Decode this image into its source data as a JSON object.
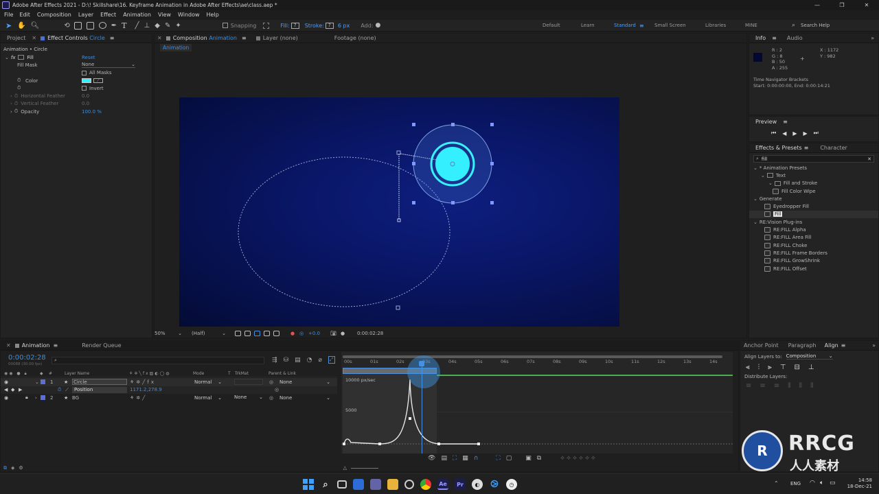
{
  "window": {
    "title": "Adobe After Effects 2021 - D:\\! Skillshare\\16. Keyframe Animation in Adobe After Effects\\ae\\class.aep *",
    "minimize": "—",
    "maximize": "❐",
    "close": "✕"
  },
  "menu": [
    "File",
    "Edit",
    "Composition",
    "Layer",
    "Effect",
    "Animation",
    "View",
    "Window",
    "Help"
  ],
  "toolbar": {
    "snapping": "Snapping",
    "fill_label": "Fill:",
    "stroke_label": "Stroke:",
    "stroke_width": "6 px",
    "add_label": "Add:",
    "workspaces": [
      "Default",
      "Learn",
      "Standard",
      "Small Screen",
      "Libraries",
      "MINE"
    ],
    "active_workspace": "Standard",
    "search": "Search Help"
  },
  "effect_controls": {
    "tab_project": "Project",
    "tab_label": "Effect Controls",
    "tab_layer": "Circle",
    "header": "Animation • Circle",
    "effect_name": "Fill",
    "reset": "Reset",
    "fill_mask_label": "Fill Mask",
    "fill_mask_value": "None",
    "all_masks": "All Masks",
    "color_label": "Color",
    "invert": "Invert",
    "h_feather": "Horizontal Feather",
    "h_feather_val": "0.0",
    "v_feather": "Vertical Feather",
    "v_feather_val": "0.0",
    "opacity_label": "Opacity",
    "opacity_val": "100.0 %",
    "swatch_color": "#34f0ff"
  },
  "composition": {
    "tab_label": "Composition",
    "tab_comp": "Animation",
    "layer_tab": "Layer (none)",
    "footage_tab": "Footage (none)",
    "sub_tab": "Animation",
    "zoom": "50%",
    "resolution": "(Half)",
    "exposure": "+0.0",
    "timecode": "0:00:02:28"
  },
  "info": {
    "tab_info": "Info",
    "tab_audio": "Audio",
    "r": "R : 2",
    "g": "G : 8",
    "b": "B : 50",
    "a": "A : 255",
    "x": "X : 1172",
    "y": "Y : 982",
    "nav_title": "Time Navigator Brackets",
    "nav_range": "Start: 0:00:00:00, End: 0:00:14:21",
    "pixel_color": "#020832"
  },
  "preview": {
    "title": "Preview"
  },
  "effects_presets": {
    "tab": "Effects & Presets",
    "tab2": "Character",
    "search": "fill",
    "items": [
      {
        "label": "* Animation Presets",
        "level": 0,
        "type": "folder"
      },
      {
        "label": "Text",
        "level": 1,
        "type": "folder"
      },
      {
        "label": "Fill and Stroke",
        "level": 2,
        "type": "folder"
      },
      {
        "label": "Fill Color Wipe",
        "level": 3,
        "type": "preset"
      },
      {
        "label": "Generate",
        "level": 0,
        "type": "folder"
      },
      {
        "label": "Eyedropper Fill",
        "level": 1,
        "type": "effect"
      },
      {
        "label": "Fill",
        "level": 1,
        "type": "effect",
        "selected": true
      },
      {
        "label": "RE:Vision Plug-ins",
        "level": 0,
        "type": "folder"
      },
      {
        "label": "RE:FILL Alpha",
        "level": 1,
        "type": "effect"
      },
      {
        "label": "RE:FILL Area Fill",
        "level": 1,
        "type": "effect"
      },
      {
        "label": "RE:FILL Choke",
        "level": 1,
        "type": "effect"
      },
      {
        "label": "RE:FILL Frame Borders",
        "level": 1,
        "type": "effect"
      },
      {
        "label": "RE:FILL GrowShrink",
        "level": 1,
        "type": "effect"
      },
      {
        "label": "RE:FILL Offset",
        "level": 1,
        "type": "effect"
      }
    ]
  },
  "timeline": {
    "tab": "Animation",
    "render_queue": "Render Queue",
    "timecode": "0:00:02:28",
    "frames": "00088 (30.00 fps)",
    "col_num": "#",
    "col_layer": "Layer Name",
    "col_mode": "Mode",
    "col_t": "T",
    "col_trkmat": "TrkMat",
    "col_parent": "Parent & Link",
    "layers": [
      {
        "num": "1",
        "name": "Circle",
        "mode": "Normal",
        "trkmat": "",
        "parent": "None"
      },
      {
        "num": "2",
        "name": "BG",
        "mode": "Normal",
        "trkmat": "None",
        "parent": "None"
      }
    ],
    "property": {
      "name": "Position",
      "value": "1171.2,278.9"
    },
    "ruler": [
      "00s",
      "01s",
      "02s",
      "03s",
      "04s",
      "05s",
      "06s",
      "07s",
      "08s",
      "09s",
      "10s",
      "11s",
      "12s",
      "13s",
      "14s"
    ],
    "graph_top": "10000 px/sec",
    "graph_mid": "5000"
  },
  "align": {
    "tab_anchor": "Anchor Point",
    "tab_paragraph": "Paragraph",
    "tab_align": "Align",
    "align_to_label": "Align Layers to:",
    "align_to_value": "Composition",
    "distribute": "Distribute Layers:"
  },
  "taskbar": {
    "lang": "ENG",
    "time": "14:58",
    "date": "18-Dec-21",
    "apps": [
      "Ae",
      "Pr"
    ]
  },
  "watermark": {
    "text": "RRCG",
    "sub": "人人素材"
  }
}
